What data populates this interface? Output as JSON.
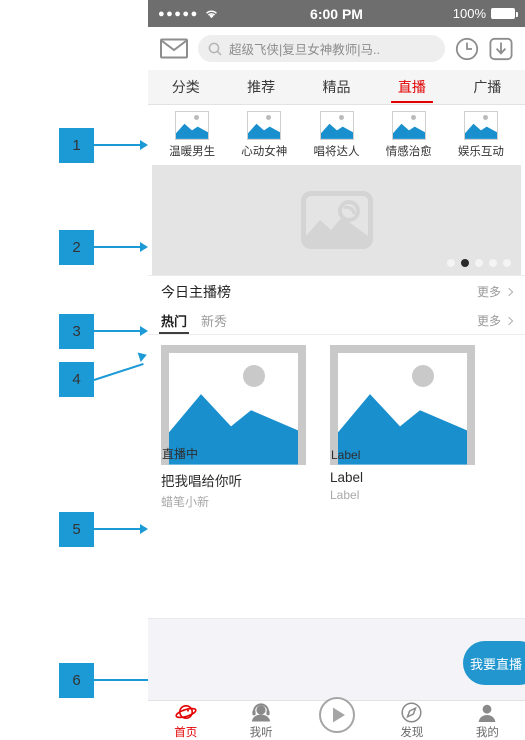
{
  "annotations": [
    {
      "num": "1"
    },
    {
      "num": "2"
    },
    {
      "num": "3"
    },
    {
      "num": "4"
    },
    {
      "num": "5"
    },
    {
      "num": "6"
    }
  ],
  "statusbar": {
    "signal_dots": "●●●●●",
    "wifi_icon": "wifi-icon",
    "time": "6:00 PM",
    "battery_percent": "100%"
  },
  "search": {
    "mail_icon": "envelope-icon",
    "search_icon": "search-icon",
    "placeholder": "超级飞侠|复旦女神教师|马..",
    "value": "",
    "history_icon": "clock-icon",
    "download_icon": "download-icon"
  },
  "top_tabs": [
    {
      "label": "分类",
      "active": false
    },
    {
      "label": "推荐",
      "active": false
    },
    {
      "label": "精品",
      "active": false
    },
    {
      "label": "直播",
      "active": true
    },
    {
      "label": "广播",
      "active": false
    }
  ],
  "categories": [
    {
      "label": "温暖男生",
      "icon": "image-placeholder-icon"
    },
    {
      "label": "心动女神",
      "icon": "image-placeholder-icon"
    },
    {
      "label": "唱将达人",
      "icon": "image-placeholder-icon"
    },
    {
      "label": "情感治愈",
      "icon": "image-placeholder-icon"
    },
    {
      "label": "娱乐互动",
      "icon": "image-placeholder-icon"
    }
  ],
  "banner": {
    "placeholder_icon": "image-placeholder-icon",
    "dots_total": 5,
    "active_dot": 2
  },
  "section": {
    "title": "今日主播榜",
    "more_label": "更多",
    "chevron_icon": "chevron-right-icon"
  },
  "sub_tabs": [
    {
      "label": "热门",
      "active": true
    },
    {
      "label": "新秀",
      "active": false
    }
  ],
  "sub_more": {
    "more_label": "更多",
    "chevron_icon": "chevron-right-icon"
  },
  "cards": [
    {
      "badge": "直播中",
      "title": "把我唱给你听",
      "subtitle": "蜡笔小新",
      "image_icon": "image-placeholder-icon"
    },
    {
      "badge": "Label",
      "title": "Label",
      "subtitle": "Label",
      "image_icon": "image-placeholder-icon"
    }
  ],
  "live_button": {
    "label": "我要直播"
  },
  "bottom_nav": [
    {
      "label": "首页",
      "icon": "planet-icon",
      "active": true
    },
    {
      "label": "我听",
      "icon": "headphone-person-icon",
      "active": false
    },
    {
      "label": "",
      "icon": "play-circle-icon",
      "active": false
    },
    {
      "label": "发现",
      "icon": "compass-icon",
      "active": false
    },
    {
      "label": "我的",
      "icon": "person-icon",
      "active": false
    }
  ],
  "colors": {
    "accent_blue": "#1b9ad6",
    "active_red": "#e30000",
    "image_blue": "#1a8fce",
    "status_gray": "#6e6e6e"
  }
}
